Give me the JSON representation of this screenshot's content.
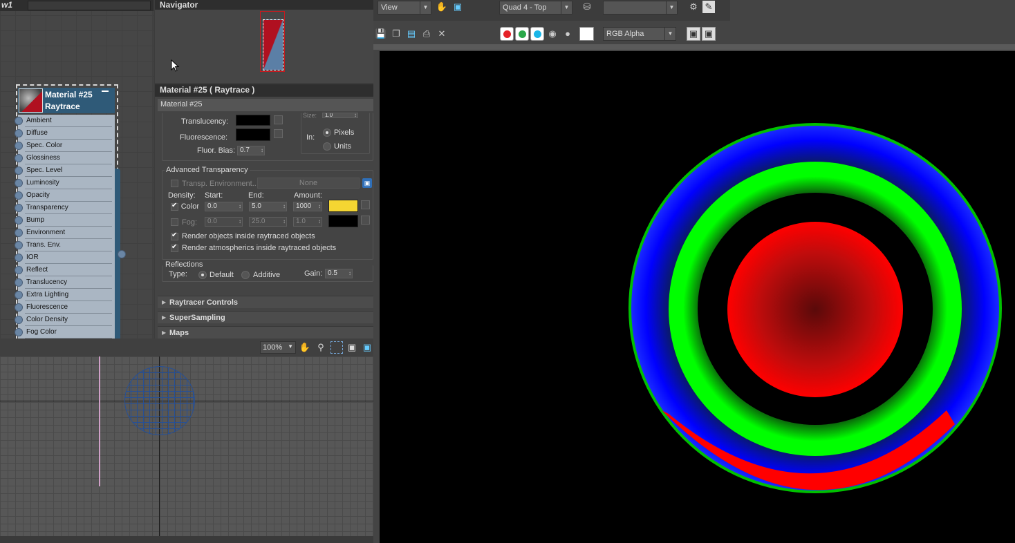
{
  "slate": {
    "title": "w1",
    "node": {
      "name_line1": "Material #25",
      "name_line2": "Raytrace",
      "slots": [
        "Ambient",
        "Diffuse",
        "Spec. Color",
        "Glossiness",
        "Spec. Level",
        "Luminosity",
        "Opacity",
        "Transparency",
        "Bump",
        "Environment",
        "Trans. Env.",
        "IOR",
        "Reflect",
        "Translucency",
        "Extra Lighting",
        "Fluorescence",
        "Color Density",
        "Fog Color"
      ]
    }
  },
  "navigator": {
    "title": "Navigator"
  },
  "material_panel": {
    "title": "Material #25  ( Raytrace )",
    "name_field": "Material #25",
    "translucency_label": "Translucency:",
    "fluorescence_label": "Fluorescence:",
    "fluor_bias_label": "Fluor. Bias:",
    "fluor_bias_value": "0.7",
    "size_label": "Size:",
    "size_value": "1.0",
    "in_label": "In:",
    "pixels_label": "Pixels",
    "units_label": "Units",
    "advanced_transparency": {
      "title": "Advanced Transparency",
      "transp_env_label": "Transp. Environment..",
      "none_button": "None",
      "density_label": "Density:",
      "start_label": "Start:",
      "end_label": "End:",
      "amount_label": "Amount:",
      "color_label": "Color:",
      "color_start": "0.0",
      "color_end": "5.0",
      "color_amount": "1000",
      "color_swatch": "#f5d632",
      "fog_label": "Fog:",
      "fog_start": "0.0",
      "fog_end": "25.0",
      "fog_amount": "1.0",
      "render_objects_label": "Render objects inside raytraced objects",
      "render_atmos_label": "Render atmospherics inside raytraced objects"
    },
    "reflections": {
      "title": "Reflections",
      "type_label": "Type:",
      "default_label": "Default",
      "additive_label": "Additive",
      "gain_label": "Gain:",
      "gain_value": "0.5"
    },
    "rollouts": [
      "Raytracer Controls",
      "SuperSampling",
      "Maps"
    ]
  },
  "viewport": {
    "zoom": "100%"
  },
  "render_frame": {
    "area_dropdown": "View",
    "viewport_dropdown": "Quad 4 - Top",
    "channel_dropdown": "RGB Alpha",
    "channel_colors": {
      "red": "#e52127",
      "green": "#2aa84a",
      "blue": "#1ab6e8"
    }
  }
}
